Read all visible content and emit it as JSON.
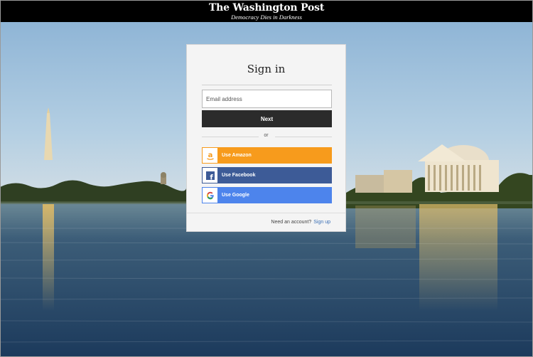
{
  "header": {
    "brand": "The Washington Post",
    "tagline": "Democracy Dies in Darkness"
  },
  "signin": {
    "title": "Sign in",
    "email_placeholder": "Email address",
    "email_value": "",
    "next_label": "Next",
    "divider_text": "or",
    "social": [
      {
        "label": "Use Amazon",
        "icon": "amazon-icon",
        "color": "#f79b1c"
      },
      {
        "label": "Use Facebook",
        "icon": "facebook-icon",
        "color": "#3d5b97"
      },
      {
        "label": "Use Google",
        "icon": "google-icon",
        "color": "#4d84ec"
      }
    ],
    "footer_text": "Need an account?",
    "signup_label": "Sign up"
  },
  "colors": {
    "header_bg": "#000000",
    "next_bg": "#2b2b2b",
    "link": "#3a6fb5"
  }
}
